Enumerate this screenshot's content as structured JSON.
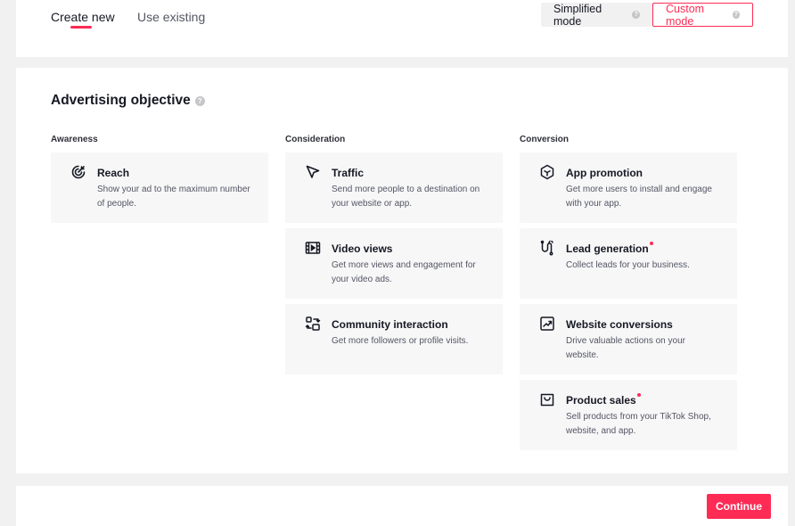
{
  "tabs": [
    {
      "label": "Create new",
      "active": true
    },
    {
      "label": "Use existing",
      "active": false
    }
  ],
  "modes": {
    "simplified": "Simplified mode",
    "custom": "Custom mode",
    "selected": "custom"
  },
  "objective": {
    "title": "Advertising objective",
    "columns": [
      {
        "label": "Awareness",
        "cards": [
          {
            "icon": "target-icon",
            "title": "Reach",
            "desc": "Show your ad to the maximum number of people.",
            "new": false
          }
        ]
      },
      {
        "label": "Consideration",
        "cards": [
          {
            "icon": "cursor-arrow-icon",
            "title": "Traffic",
            "desc": "Send more people to a destination on your website or app.",
            "new": false
          },
          {
            "icon": "video-film-icon",
            "title": "Video views",
            "desc": "Get more views and engagement for your video ads.",
            "new": false
          },
          {
            "icon": "community-exchange-icon",
            "title": "Community interaction",
            "desc": "Get more followers or profile visits.",
            "new": false
          }
        ]
      },
      {
        "label": "Conversion",
        "cards": [
          {
            "icon": "app-cube-icon",
            "title": "App promotion",
            "desc": "Get more users to install and engage with your app.",
            "new": false
          },
          {
            "icon": "lead-magnet-icon",
            "title": "Lead generation",
            "desc": "Collect leads for your business.",
            "new": true
          },
          {
            "icon": "trend-chart-icon",
            "title": "Website conversions",
            "desc": "Drive valuable actions on your website.",
            "new": false
          },
          {
            "icon": "shopping-bag-icon",
            "title": "Product sales",
            "desc": "Sell products from your TikTok Shop, website, and app.",
            "new": true
          }
        ]
      }
    ]
  },
  "footer": {
    "continue_label": "Continue"
  },
  "colors": {
    "accent": "#fe2c55"
  }
}
